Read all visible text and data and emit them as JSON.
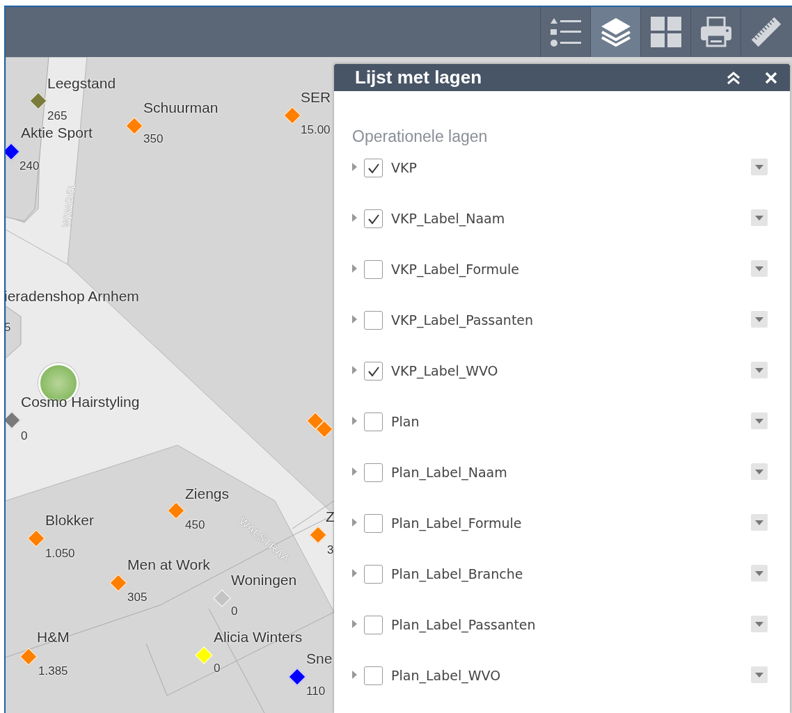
{
  "toolbar": {
    "tools": [
      {
        "kind": "legend",
        "selected": false
      },
      {
        "kind": "layers",
        "selected": true
      },
      {
        "kind": "basemap",
        "selected": false
      },
      {
        "kind": "print",
        "selected": false
      },
      {
        "kind": "measure",
        "selected": false
      }
    ]
  },
  "map": {
    "street_labels": [
      "WINGEL",
      "WALSTRAA"
    ],
    "features": [
      {
        "name": "Leegstand",
        "value": "265",
        "color": "#7b7b3c"
      },
      {
        "name": "Schuurman",
        "value": "350",
        "color": "#ff7f00"
      },
      {
        "name": "SER",
        "value": "15.00",
        "color": "#ff7f00"
      },
      {
        "name": "Aktie Sport",
        "value": "240",
        "color": "#0000ff"
      },
      {
        "name": "ieradenshop Arnhem",
        "value": "5"
      },
      {
        "name": "Cosmo Hairstyling",
        "value": "0",
        "color": "#7a7a7a"
      },
      {
        "name": "Ziengs",
        "value": "450",
        "color": "#ff7f00"
      },
      {
        "name": "Blokker",
        "value": "1.050",
        "color": "#ff7f00"
      },
      {
        "name": "Z",
        "value": "3",
        "color": "#ff7f00"
      },
      {
        "name": "Men at Work",
        "value": "305",
        "color": "#ff7f00"
      },
      {
        "name": "Woningen",
        "value": "0",
        "color": "#c4c4c4"
      },
      {
        "name": "H&M",
        "value": "1.385",
        "color": "#ff7f00"
      },
      {
        "name": "Alicia Winters",
        "value": "0",
        "color": "#ffff00"
      },
      {
        "name": "Sne",
        "value": "110",
        "color": "#0000ff"
      }
    ],
    "unlabeled_markers": [
      {
        "color": "#ff7f00"
      },
      {
        "color": "#ff7f00"
      }
    ]
  },
  "panel": {
    "title": "Lijst met lagen",
    "section": "Operationele lagen",
    "layers": [
      {
        "name": "VKP",
        "checked": true
      },
      {
        "name": "VKP_Label_Naam",
        "checked": true
      },
      {
        "name": "VKP_Label_Formule",
        "checked": false
      },
      {
        "name": "VKP_Label_Passanten",
        "checked": false
      },
      {
        "name": "VKP_Label_WVO",
        "checked": true
      },
      {
        "name": "Plan",
        "checked": false
      },
      {
        "name": "Plan_Label_Naam",
        "checked": false
      },
      {
        "name": "Plan_Label_Formule",
        "checked": false
      },
      {
        "name": "Plan_Label_Branche",
        "checked": false
      },
      {
        "name": "Plan_Label_Passanten",
        "checked": false
      },
      {
        "name": "Plan_Label_WVO",
        "checked": false
      }
    ]
  }
}
